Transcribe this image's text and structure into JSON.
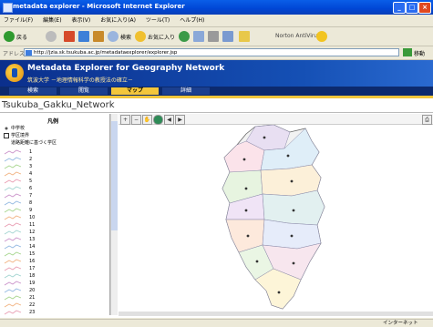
{
  "window": {
    "title": "metadata explorer - Microsoft Internet Explorer"
  },
  "menu": {
    "items": [
      "ファイル(F)",
      "編集(E)",
      "表示(V)",
      "お気に入り(A)",
      "ツール(T)",
      "ヘルプ(H)"
    ]
  },
  "toolbar": {
    "back_label": "戻る",
    "search_label": "検索",
    "favorites_label": "お気に入り",
    "antivirus_label": "Norton AntiVirus"
  },
  "address": {
    "label": "アドレス(D)",
    "url": "http://jzia.sk.tsukuba.ac.jp/metadataexplorer/explorer.jsp",
    "go_label": "移動"
  },
  "banner": {
    "title": "Metadata Explorer for Geography Network",
    "subtitle": "筑波大学 －地理情報科学の教授法の確立－"
  },
  "tabs": [
    "検索",
    "閲覧",
    "マップ",
    "詳細"
  ],
  "network_name": "Tsukuba_Gakku_Network",
  "legend": {
    "title": "凡例",
    "symbols": [
      "中学校",
      "学区境界",
      "道路距離に基づく学区"
    ],
    "numbered": [
      "1",
      "2",
      "3",
      "4",
      "5",
      "6",
      "7",
      "8",
      "9",
      "10",
      "11",
      "12",
      "13",
      "14",
      "15",
      "16",
      "17",
      "18",
      "19",
      "20",
      "21",
      "22",
      "23"
    ]
  },
  "map_tools": [
    "zoom-in",
    "zoom-out",
    "pan",
    "globe",
    "previous",
    "next",
    "print"
  ],
  "status": {
    "text": "インターネット"
  },
  "colors": {
    "banner": "#1550b5",
    "tab_active": "#f3c63b",
    "title_bar": "#0046d5"
  }
}
